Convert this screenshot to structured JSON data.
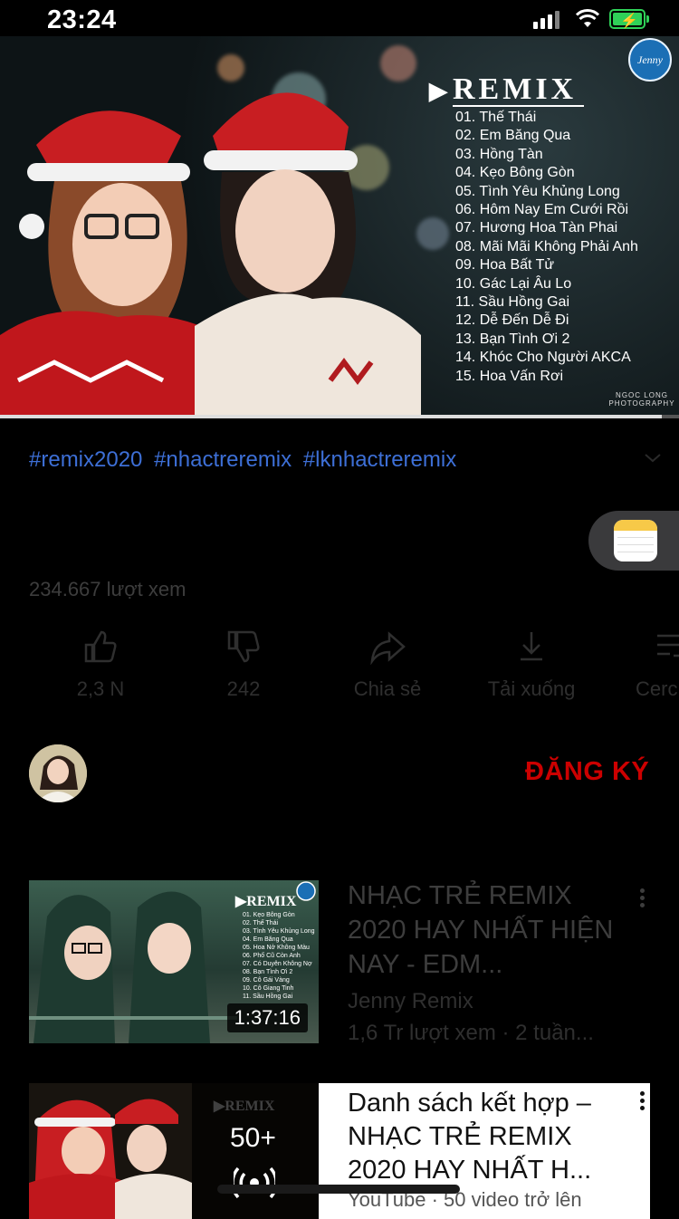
{
  "status": {
    "time": "23:24"
  },
  "hero": {
    "logo_text": "REMIX",
    "badge_text": "Jenny",
    "credit": "NGOC LONG PHOTOGRAPHY",
    "tracks": [
      "01. Thế Thái",
      "02. Em Băng Qua",
      "03. Hồng Tàn",
      "04. Kẹo Bông Gòn",
      "05. Tình Yêu Khủng Long",
      "06. Hôm Nay Em Cưới Rồi",
      "07. Hương Hoa Tàn Phai",
      "08. Mãi Mãi Không Phải Anh",
      "09. Hoa Bất Tử",
      "10. Gác Lại Âu Lo",
      "11. Sầu Hồng Gai",
      "12. Dễ Đến Dễ Đi",
      "13. Bạn Tình Ơi 2",
      "14. Khóc Cho Người AKCA",
      "15. Hoa Vấn Rơi"
    ],
    "progress_fraction": 0.975
  },
  "description": {
    "hashtags": [
      "#remix2020",
      "#nhactreremix",
      "#lknhactreremix"
    ]
  },
  "views_text": "234.667 lượt xem",
  "actions": {
    "like": "2,3 N",
    "dislike": "242",
    "share": "Chia sẻ",
    "download": "Tải xuống",
    "save": "Cerc"
  },
  "channel": {
    "subscribe": "ĐĂNG KÝ"
  },
  "videos": [
    {
      "title": "NHẠC TRẺ REMIX 2020 HAY NHẤT HIỆN NAY - EDM...",
      "channel": "Jenny Remix",
      "meta": "1,6 Tr lượt xem · 2 tuần...",
      "duration": "1:37:16"
    },
    {
      "title": "Danh sách kết hợp – NHẠC TRẺ REMIX 2020 HAY NHẤT H...",
      "subtitle": "YouTube · 50 video trở lên",
      "count": "50+"
    }
  ],
  "colors": {
    "accent_red": "#cc0000",
    "link_blue": "#3d6fd6",
    "battery_green": "#2fd158"
  }
}
